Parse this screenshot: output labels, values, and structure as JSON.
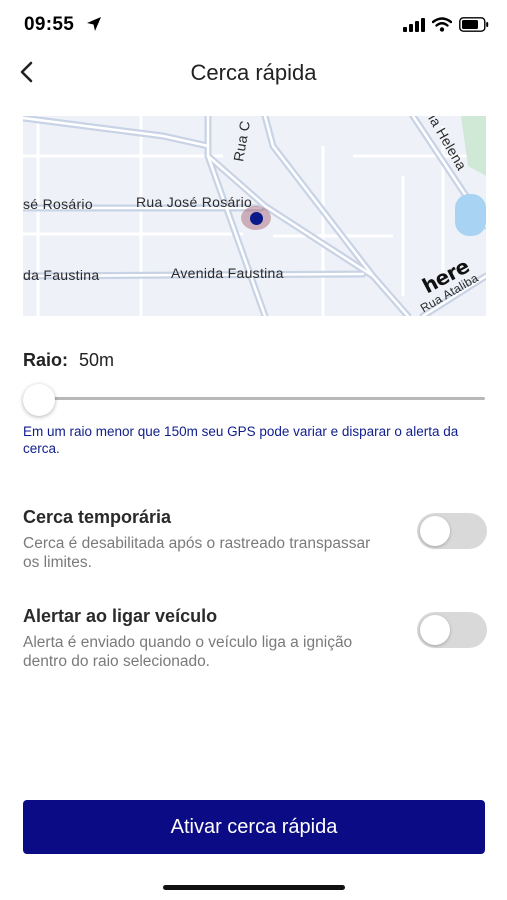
{
  "status_bar": {
    "time": "09:55",
    "icons": [
      "location-arrow-icon",
      "cellular-signal-icon",
      "wifi-icon",
      "battery-icon"
    ]
  },
  "header": {
    "back_icon": "chevron-left-icon",
    "title": "Cerca rápida"
  },
  "map": {
    "street_labels": [
      "Rua José Rosário",
      "sé Rosário",
      "Avenida Faustina",
      "da Faustina",
      "Rua C",
      "ria Helena",
      "Rua Ataliba"
    ],
    "provider_logo": "here"
  },
  "radius": {
    "label": "Raio:",
    "value": "50m",
    "slider_fraction": 0.0,
    "hint": "Em um raio menor que 150m seu GPS pode variar e disparar o alerta da cerca."
  },
  "settings": [
    {
      "title": "Cerca temporária",
      "description": "Cerca é desabilitada após o rastreado transpassar os limites.",
      "enabled": false
    },
    {
      "title": "Alertar ao ligar veículo",
      "description": "Alerta é enviado quando o veículo liga a ignição dentro do raio selecionado.",
      "enabled": false
    }
  ],
  "primary_button": {
    "label": "Ativar cerca rápida"
  },
  "colors": {
    "primary": "#0c0b86",
    "hint_text": "#0f1e8c",
    "pin": "#0b1a8a",
    "toggle_off": "#d9d9d9"
  }
}
